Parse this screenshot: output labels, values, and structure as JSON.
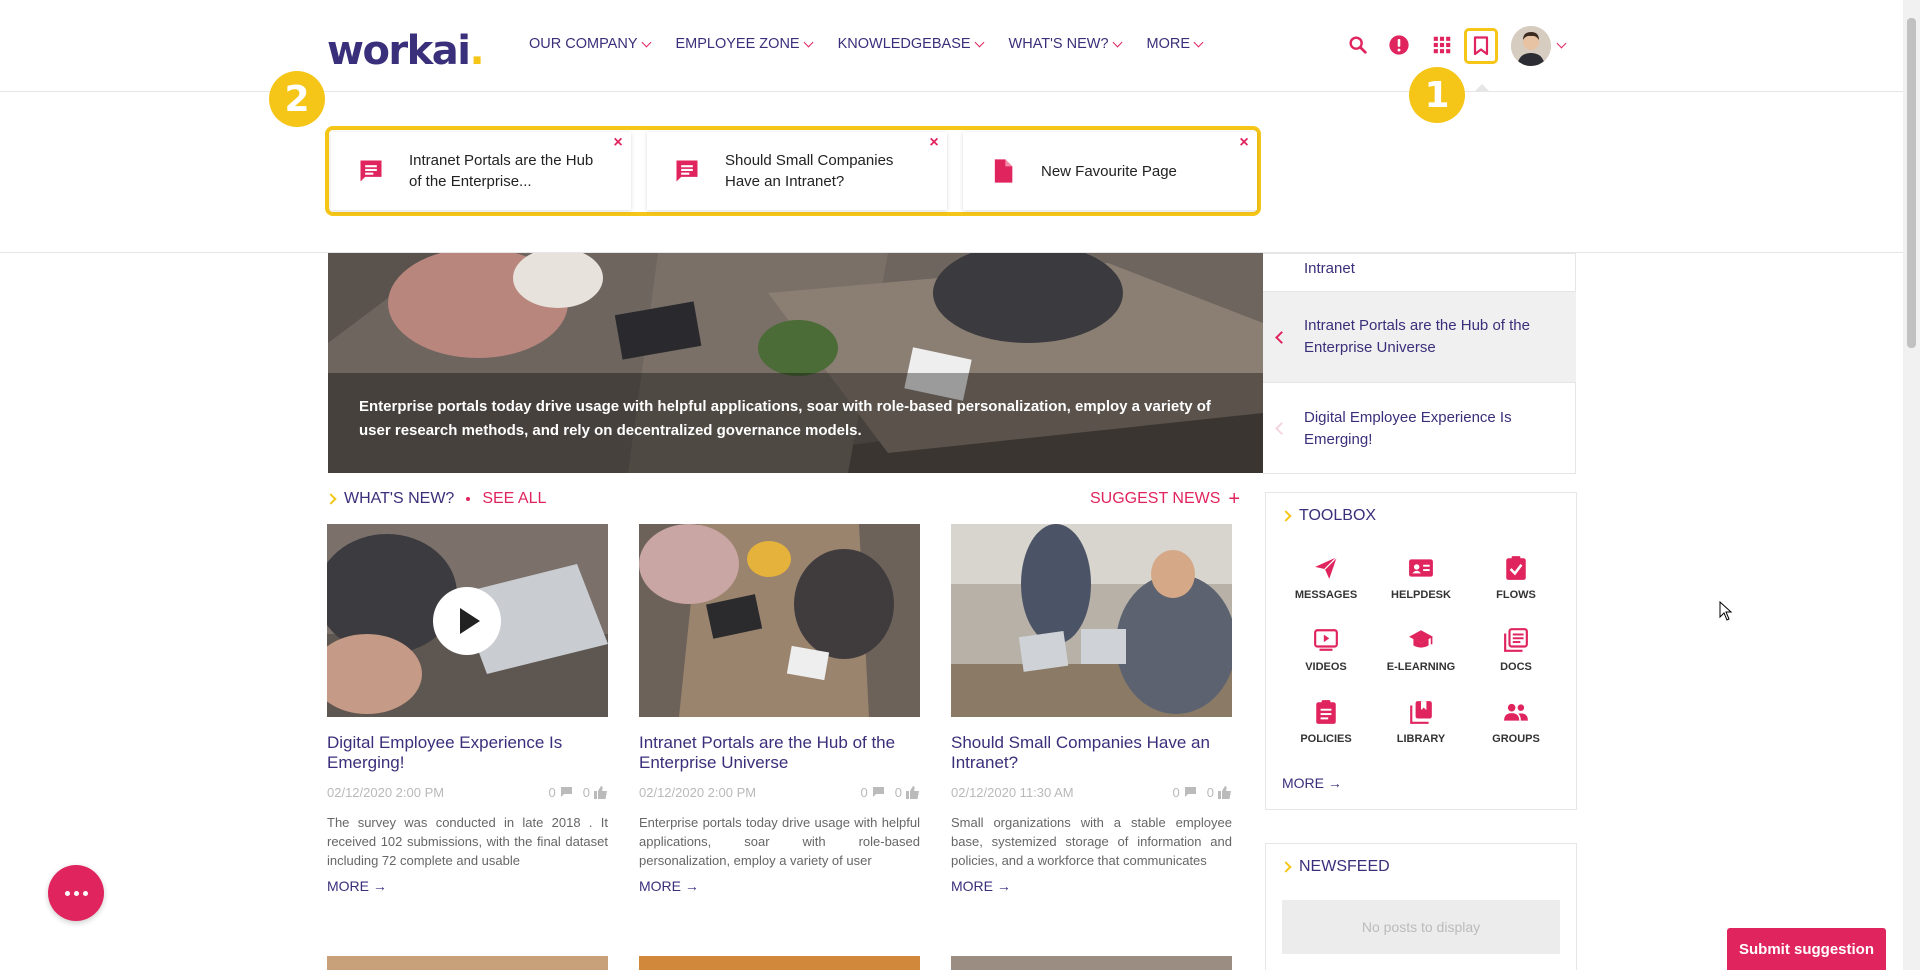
{
  "brand": {
    "name": "workai",
    "dot": ".",
    "accent": "#e0245e",
    "primary": "#3a2f7a",
    "highlight": "#f5c518"
  },
  "nav": [
    {
      "label": "OUR COMPANY"
    },
    {
      "label": "EMPLOYEE ZONE"
    },
    {
      "label": "KNOWLEDGEBASE"
    },
    {
      "label": "WHAT'S NEW?"
    },
    {
      "label": "MORE"
    }
  ],
  "header_icons": [
    "search-icon",
    "alert-icon",
    "apps-grid-icon",
    "bookmark-icon",
    "avatar"
  ],
  "badges": {
    "one": "1",
    "two": "2"
  },
  "bookmarks": [
    {
      "title": "Intranet Portals are the Hub of the Enterprise...",
      "icon": "comment-icon"
    },
    {
      "title": "Should Small Companies Have an Intranet?",
      "icon": "comment-icon"
    },
    {
      "title": "New Favourite Page",
      "icon": "document-icon"
    }
  ],
  "hero": {
    "text": "Enterprise portals today drive usage with helpful applications, soar with role-based personalization, employ a variety of user research methods, and rely on decentralized governance models."
  },
  "slider": [
    {
      "title": "Intranet"
    },
    {
      "title": "Intranet Portals are the Hub of the Enterprise Universe"
    },
    {
      "title": "Digital Employee Experience Is Emerging!"
    }
  ],
  "whats_new": {
    "title": "WHAT'S NEW?",
    "see_all": "SEE ALL",
    "suggest": "SUGGEST NEWS",
    "suggest_icon": "+"
  },
  "news": [
    {
      "title": "Digital Employee Experience Is Emerging!",
      "date": "02/12/2020 2:00 PM",
      "comments": "0",
      "likes": "0",
      "excerpt": "The survey was conducted in late 2018 . It received 102 submissions, with the final dataset including 72 complete and usable",
      "more": "MORE →"
    },
    {
      "title": "Intranet Portals are the Hub of the Enterprise Universe",
      "date": "02/12/2020 2:00 PM",
      "comments": "0",
      "likes": "0",
      "excerpt": "Enterprise portals today drive usage with helpful applications, soar with role-based personalization, employ a variety of user",
      "more": "MORE →"
    },
    {
      "title": "Should Small Companies Have an Intranet?",
      "date": "02/12/2020 11:30 AM",
      "comments": "0",
      "likes": "0",
      "excerpt": "Small organizations with a stable employee base, systemized storage of information and policies, and a workforce that communicates",
      "more": "MORE →"
    }
  ],
  "toolbox": {
    "title": "TOOLBOX",
    "items": [
      {
        "label": "MESSAGES",
        "icon": "paper-plane-icon"
      },
      {
        "label": "HELPDESK",
        "icon": "contact-card-icon"
      },
      {
        "label": "FLOWS",
        "icon": "clipboard-check-icon"
      },
      {
        "label": "VIDEOS",
        "icon": "video-icon"
      },
      {
        "label": "E-LEARNING",
        "icon": "graduation-cap-icon"
      },
      {
        "label": "DOCS",
        "icon": "docs-stack-icon"
      },
      {
        "label": "POLICIES",
        "icon": "clipboard-list-icon"
      },
      {
        "label": "LIBRARY",
        "icon": "books-icon"
      },
      {
        "label": "GROUPS",
        "icon": "people-icon"
      }
    ],
    "more": "MORE →"
  },
  "newsfeed": {
    "title": "NEWSFEED",
    "empty": "No posts to display"
  },
  "submit": {
    "label": "Submit suggestion"
  }
}
